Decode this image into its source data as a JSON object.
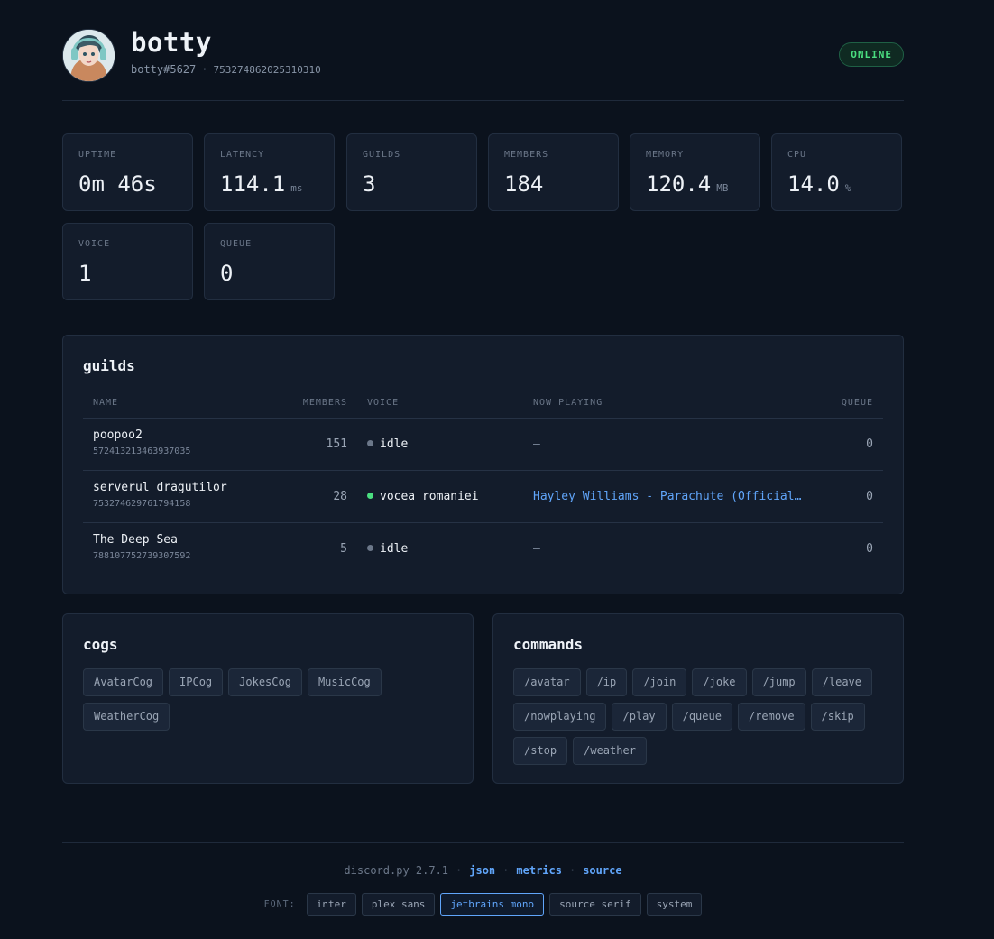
{
  "bot": {
    "name": "botty",
    "tag": "botty#5627",
    "id": "753274862025310310",
    "status": "ONLINE"
  },
  "stats": [
    {
      "label": "UPTIME",
      "value": "0m 46s",
      "unit": ""
    },
    {
      "label": "LATENCY",
      "value": "114.1",
      "unit": "ms"
    },
    {
      "label": "GUILDS",
      "value": "3",
      "unit": ""
    },
    {
      "label": "MEMBERS",
      "value": "184",
      "unit": ""
    },
    {
      "label": "MEMORY",
      "value": "120.4",
      "unit": "MB"
    },
    {
      "label": "CPU",
      "value": "14.0",
      "unit": "%"
    },
    {
      "label": "VOICE",
      "value": "1",
      "unit": ""
    },
    {
      "label": "QUEUE",
      "value": "0",
      "unit": ""
    }
  ],
  "guilds": {
    "title": "guilds",
    "columns": {
      "name": "NAME",
      "members": "MEMBERS",
      "voice": "VOICE",
      "now_playing": "NOW PLAYING",
      "queue": "QUEUE"
    },
    "rows": [
      {
        "name": "poopoo2",
        "id": "572413213463937035",
        "members": "151",
        "voice": "idle",
        "voice_color": "#6b7789",
        "now_playing": "—",
        "queue": "0"
      },
      {
        "name": "serverul dragutilor",
        "id": "753274629761794158",
        "members": "28",
        "voice": "vocea romaniei",
        "voice_color": "#4ade80",
        "now_playing": "Hayley Williams - Parachute (Official V…",
        "queue": "0"
      },
      {
        "name": "The Deep Sea",
        "id": "788107752739307592",
        "members": "5",
        "voice": "idle",
        "voice_color": "#6b7789",
        "now_playing": "—",
        "queue": "0"
      }
    ]
  },
  "cogs": {
    "title": "cogs",
    "items": [
      "AvatarCog",
      "IPCog",
      "JokesCog",
      "MusicCog",
      "WeatherCog"
    ]
  },
  "commands": {
    "title": "commands",
    "items": [
      "/avatar",
      "/ip",
      "/join",
      "/joke",
      "/jump",
      "/leave",
      "/nowplaying",
      "/play",
      "/queue",
      "/remove",
      "/skip",
      "/stop",
      "/weather"
    ]
  },
  "footer": {
    "version": "discord.py 2.7.1",
    "links": [
      "json",
      "metrics",
      "source"
    ],
    "font_label": "FONT:",
    "fonts": [
      "inter",
      "plex sans",
      "jetbrains mono",
      "source serif",
      "system"
    ],
    "active_font": "jetbrains mono"
  },
  "colors": {
    "accent": "#60a5fa",
    "online": "#4ade80",
    "background": "#0b121d"
  }
}
